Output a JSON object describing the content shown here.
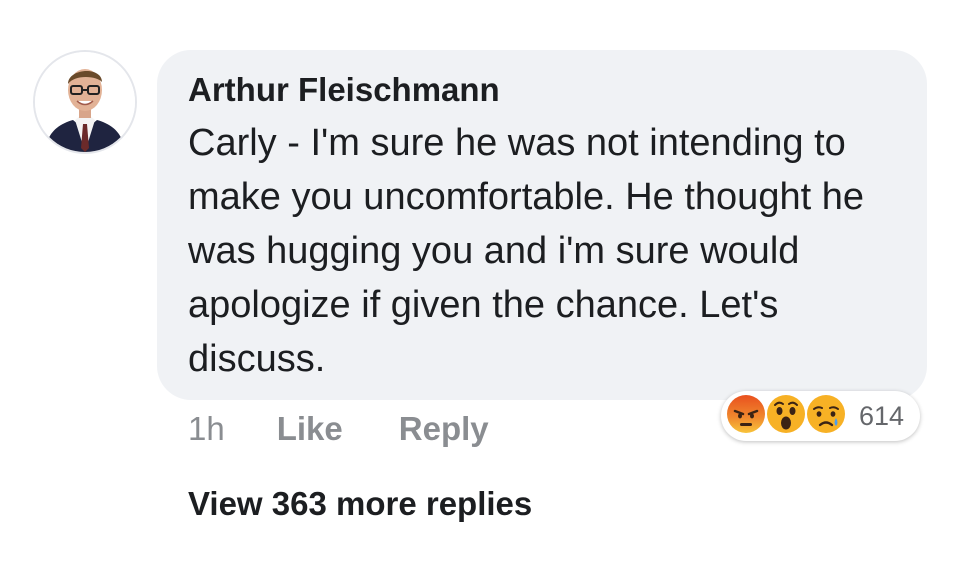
{
  "comment": {
    "author": "Arthur Fleischmann",
    "text": "Carly - I'm sure he was not intending to make you uncomfortable. He thought he was hugging you and i'm sure would apologize if given the chance. Let's discuss.",
    "time": "1h",
    "like_label": "Like",
    "reply_label": "Reply",
    "reactions": {
      "icons": [
        "angry-reaction-icon",
        "wow-reaction-icon",
        "sad-reaction-icon"
      ],
      "count": "614"
    }
  },
  "view_more_replies": "View 363 more replies",
  "colors": {
    "bubble_bg": "#f0f2f5",
    "meta_text": "#8a8d91",
    "primary_text": "#1c1e21",
    "angry": "#e9710f",
    "wow_sad": "#f7b125"
  }
}
